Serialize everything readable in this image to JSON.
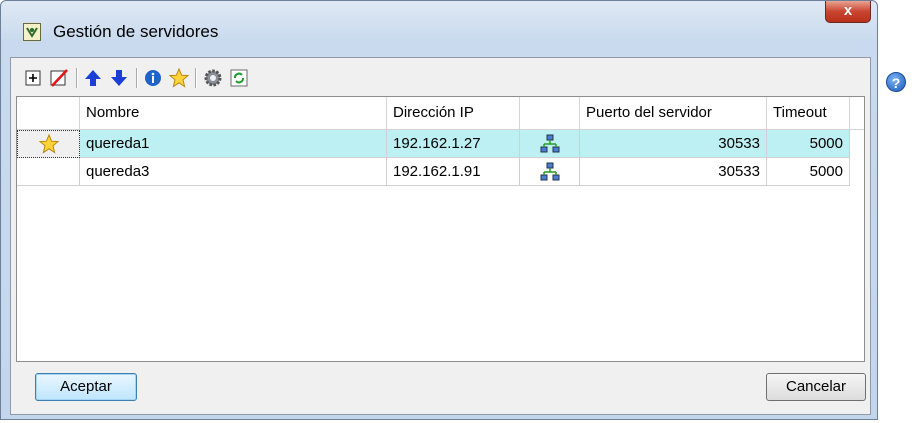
{
  "window": {
    "title": "Gestión de servidores",
    "close_glyph": "x"
  },
  "toolbar": {
    "icons": [
      "add-icon",
      "delete-icon",
      "arrow-up-icon",
      "arrow-down-icon",
      "info-icon",
      "star-icon",
      "gear-icon",
      "refresh-icon"
    ]
  },
  "help": {
    "glyph": "?"
  },
  "grid": {
    "columns": [
      "",
      "Nombre",
      "Dirección IP",
      "",
      "Puerto del servidor",
      "Timeout"
    ],
    "rows": [
      {
        "default": true,
        "name": "quereda1",
        "ip": "192.162.1.27",
        "port": "30533",
        "timeout": "5000",
        "selected": true
      },
      {
        "default": false,
        "name": "quereda3",
        "ip": "192.162.1.91",
        "port": "30533",
        "timeout": "5000",
        "selected": false
      }
    ]
  },
  "buttons": {
    "accept": "Aceptar",
    "cancel": "Cancelar"
  },
  "colors": {
    "selection": "#bdf0f2",
    "close": "#c9452f",
    "arrow": "#1a3fd6"
  }
}
